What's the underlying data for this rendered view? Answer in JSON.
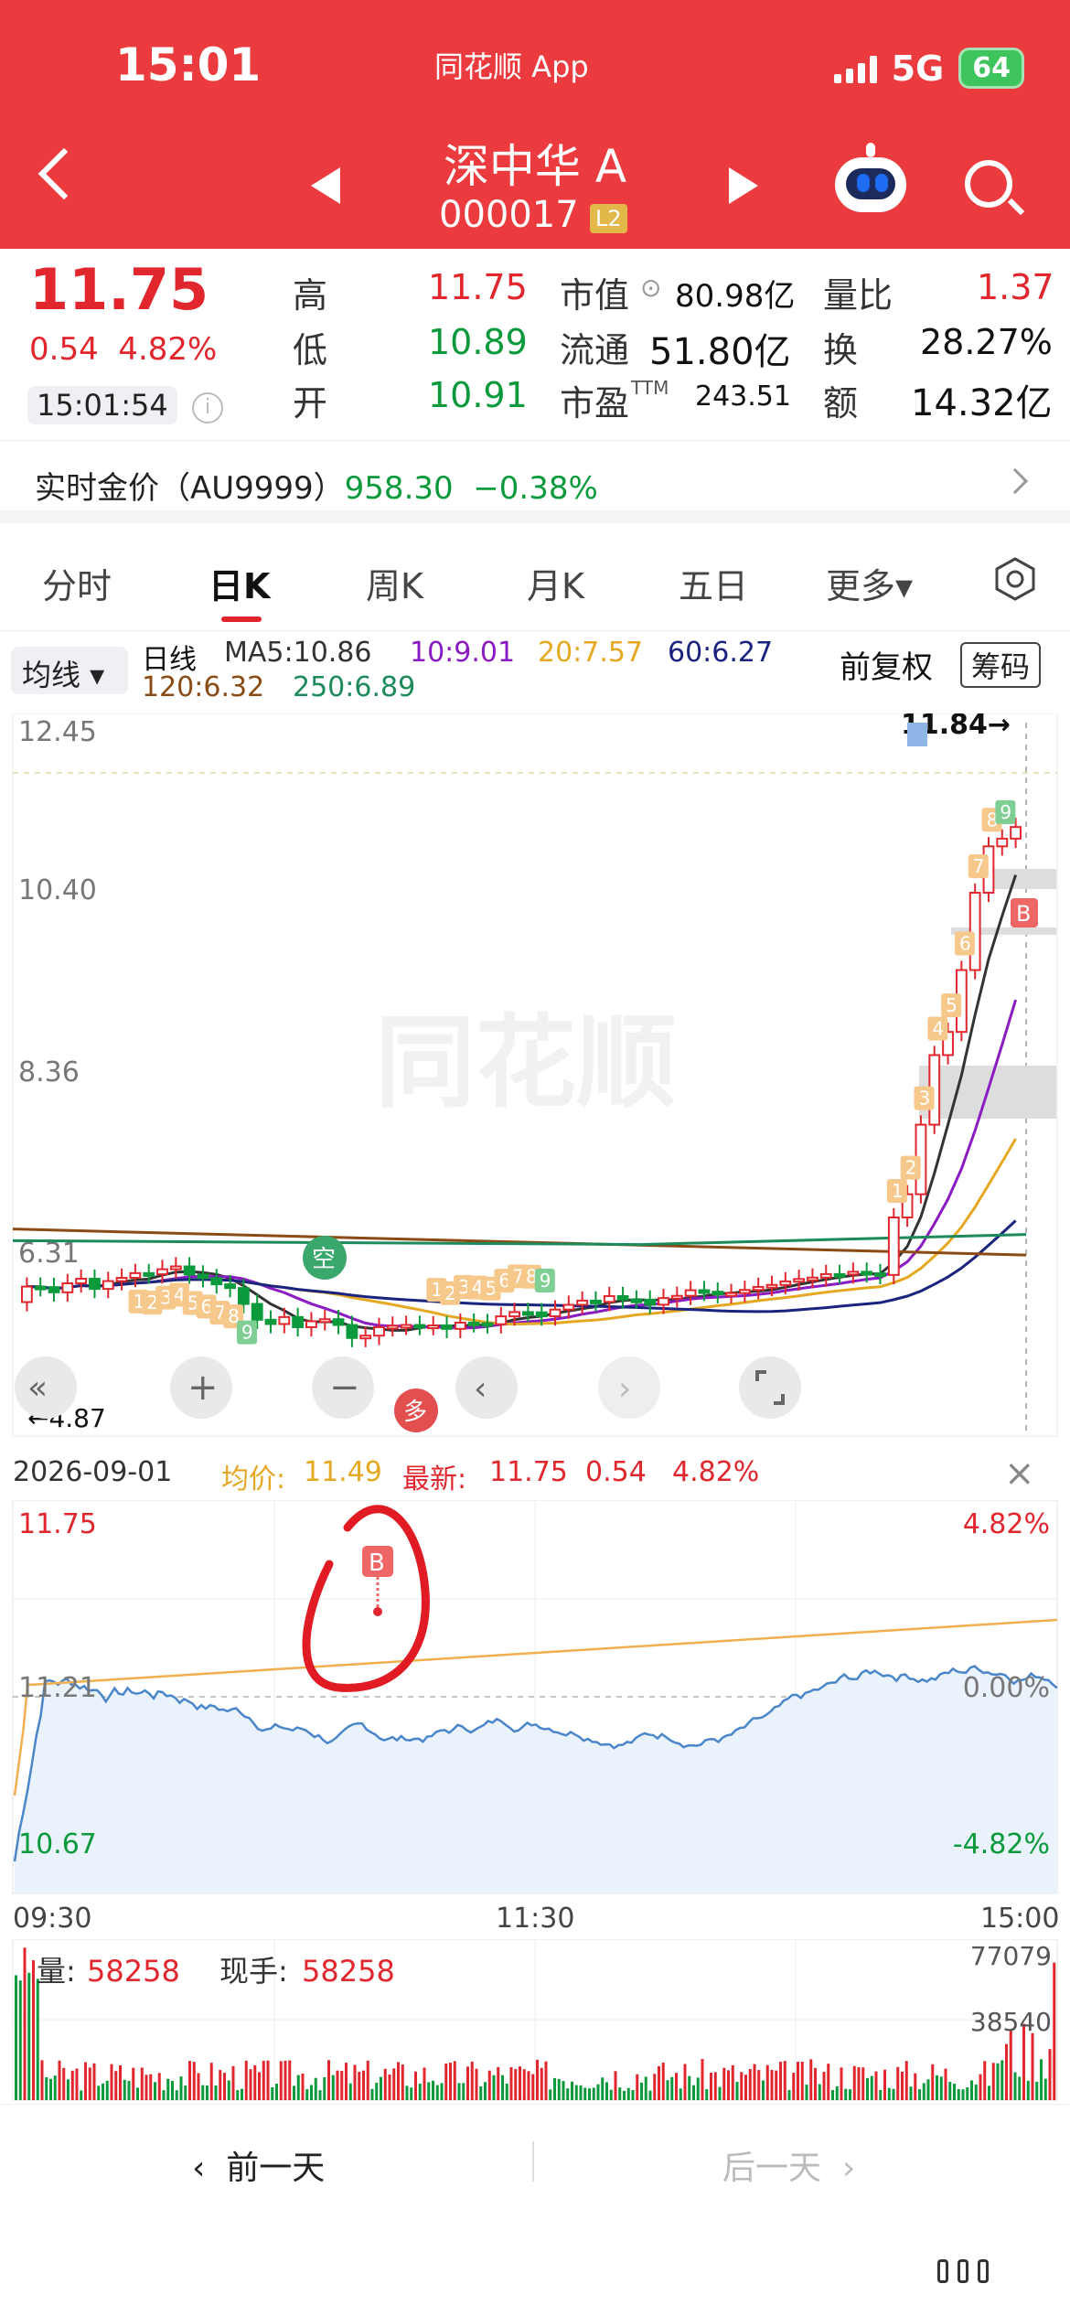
{
  "status_bar": {
    "time": "15:01",
    "app": "同花顺 App",
    "network": "5G",
    "battery": "64"
  },
  "nav": {
    "stock_name": "深中华 A",
    "stock_code": "000017",
    "level_badge": "L2"
  },
  "quote": {
    "price": "11.75",
    "change": "0.54",
    "change_pct": "4.82%",
    "time": "15:01:54",
    "high_label": "高",
    "high": "11.75",
    "low_label": "低",
    "low": "10.89",
    "open_label": "开",
    "open": "10.91",
    "mktcap_label": "市值",
    "mktcap": "80.98亿",
    "float_label": "流通",
    "float": "51.80亿",
    "pe_label": "市盈",
    "pe_sup": "TTM",
    "pe": "243.51",
    "vol_ratio_label": "量比",
    "vol_ratio": "1.37",
    "turnover_label": "换",
    "turnover": "28.27%",
    "amount_label": "额",
    "amount": "14.32亿"
  },
  "gold": {
    "label": "实时金价（AU9999）",
    "price": "958.30",
    "change": "−0.38%"
  },
  "tabs": [
    "分时",
    "日K",
    "周K",
    "月K",
    "五日",
    "更多▾"
  ],
  "ma": {
    "button": "均线 ▾",
    "period": "日线",
    "ma5": "MA5:10.86",
    "ma10": "10:9.01",
    "ma20": "20:7.57",
    "ma60": "60:6.27",
    "ma120": "120:6.32",
    "ma250": "250:6.89",
    "fuquan": "前复权",
    "chouma": "筹码"
  },
  "kline": {
    "y_labels": [
      "12.45",
      "10.40",
      "8.36",
      "6.31"
    ],
    "high_mark": "11.84→",
    "low_mark": "←4.87",
    "watermark": "同花顺",
    "kong": "空",
    "duo": "多",
    "buy": "B",
    "seq_numbers": [
      "1",
      "2",
      "3",
      "4",
      "5",
      "6",
      "7",
      "8",
      "9"
    ],
    "colors": {
      "up": "#e1262d",
      "down": "#0a9a3c",
      "ma5": "#333333",
      "ma10": "#8a1bc2",
      "ma20": "#e5a823",
      "ma60": "#1a237e",
      "ma120": "#8a4b14",
      "ma250": "#1c8a5a"
    }
  },
  "intraday": {
    "date": "2026-09-01",
    "avg_label": "均价:",
    "avg": "11.49",
    "latest_label": "最新:",
    "latest": "11.75",
    "chg": "0.54",
    "chg_pct": "4.82%",
    "y_left": [
      "11.75",
      "11.21",
      "10.67"
    ],
    "y_right": [
      "4.82%",
      "0.00%",
      "-4.82%"
    ],
    "x_labels": [
      "09:30",
      "11:30",
      "15:00"
    ],
    "buy": "B"
  },
  "volume": {
    "vol_label": "量:",
    "vol": "58258",
    "cur_label": "现手:",
    "cur": "58258",
    "y_labels": [
      "77079",
      "38540"
    ]
  },
  "bottom_nav": {
    "prev": "前一天",
    "next": "后一天"
  }
}
